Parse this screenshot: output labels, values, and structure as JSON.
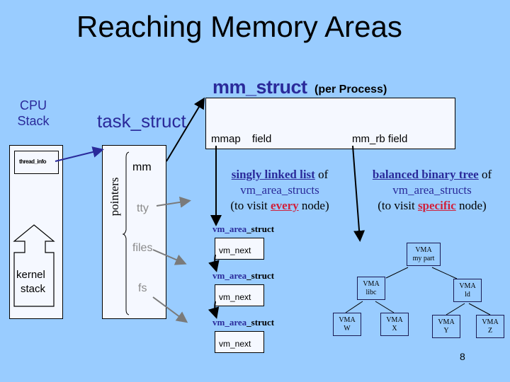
{
  "slide": {
    "title": "Reaching Memory Areas",
    "page_number": "8",
    "background_color": "#99ccff"
  },
  "cpu_stack": {
    "label_line1": "CPU",
    "label_line2": "Stack",
    "thread_info": "thread_info",
    "kernel_stack_line1": "kernel",
    "kernel_stack_line2": "stack"
  },
  "task_struct": {
    "label": "task_struct",
    "pointers_label": "pointers",
    "fields": [
      "mm",
      "tty",
      "files",
      "fs"
    ]
  },
  "mm_struct": {
    "label": "mm_struct",
    "sublabel": "(per Process)",
    "mmap_field": "mmap field",
    "mm_rb_field": "mm_rb field"
  },
  "linked_list": {
    "desc_underlined": "singly linked list",
    "desc_of": " of",
    "desc_line2": "vm_area_structs",
    "desc_line3_pre": "(to visit ",
    "desc_line3_emph": "every",
    "desc_line3_post": " node)",
    "node_label_blue": "vm_area",
    "node_label_black": "_struct",
    "next_field": "vm_next",
    "node_count": 3
  },
  "binary_tree": {
    "desc_underlined": "balanced binary tree",
    "desc_of": " of",
    "desc_line2": "vm_area_structs",
    "desc_line3_pre": "(to visit ",
    "desc_line3_emph": "specific",
    "desc_line3_post": " node)",
    "nodes": [
      {
        "line1": "VMA",
        "line2": "my part"
      },
      {
        "line1": "VMA",
        "line2": "libc"
      },
      {
        "line1": "VMA",
        "line2": "ld"
      },
      {
        "line1": "VMA",
        "line2": "W"
      },
      {
        "line1": "VMA",
        "line2": "X"
      },
      {
        "line1": "VMA",
        "line2": "Y"
      },
      {
        "line1": "VMA",
        "line2": "Z"
      }
    ]
  },
  "colors": {
    "dark_blue": "#2a2a9a",
    "emphasis_red": "#d0203c",
    "gray_field": "#8a8a8a",
    "box_fill": "#f5f8ff"
  }
}
